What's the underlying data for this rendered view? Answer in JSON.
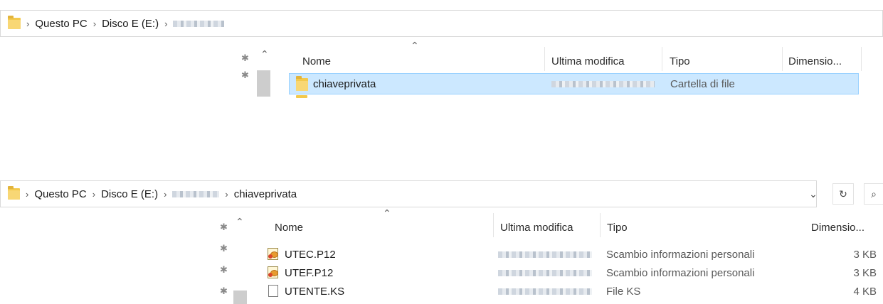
{
  "top": {
    "breadcrumb": {
      "pc": "Questo PC",
      "disk": "Disco E (E:)"
    },
    "columns": {
      "name": "Nome",
      "modified": "Ultima modifica",
      "type": "Tipo",
      "size": "Dimensio..."
    },
    "rows": [
      {
        "name": "chiaveprivata",
        "type": "Cartella di file",
        "icon": "folder-icon"
      }
    ]
  },
  "bottom": {
    "breadcrumb": {
      "pc": "Questo PC",
      "disk": "Disco E (E:)",
      "folder": "chiaveprivata"
    },
    "columns": {
      "name": "Nome",
      "modified": "Ultima modifica",
      "type": "Tipo",
      "size": "Dimensio..."
    },
    "rows": [
      {
        "name": "UTEC.P12",
        "type": "Scambio informazioni personali",
        "size": "3 KB",
        "icon": "certificate-icon"
      },
      {
        "name": "UTEF.P12",
        "type": "Scambio informazioni personali",
        "size": "3 KB",
        "icon": "certificate-icon"
      },
      {
        "name": "UTENTE.KS",
        "type": "File KS",
        "size": "4 KB",
        "icon": "file-icon"
      }
    ],
    "controls": {
      "dropdown": "⌄",
      "refresh": "↻",
      "search": "⌕"
    }
  }
}
